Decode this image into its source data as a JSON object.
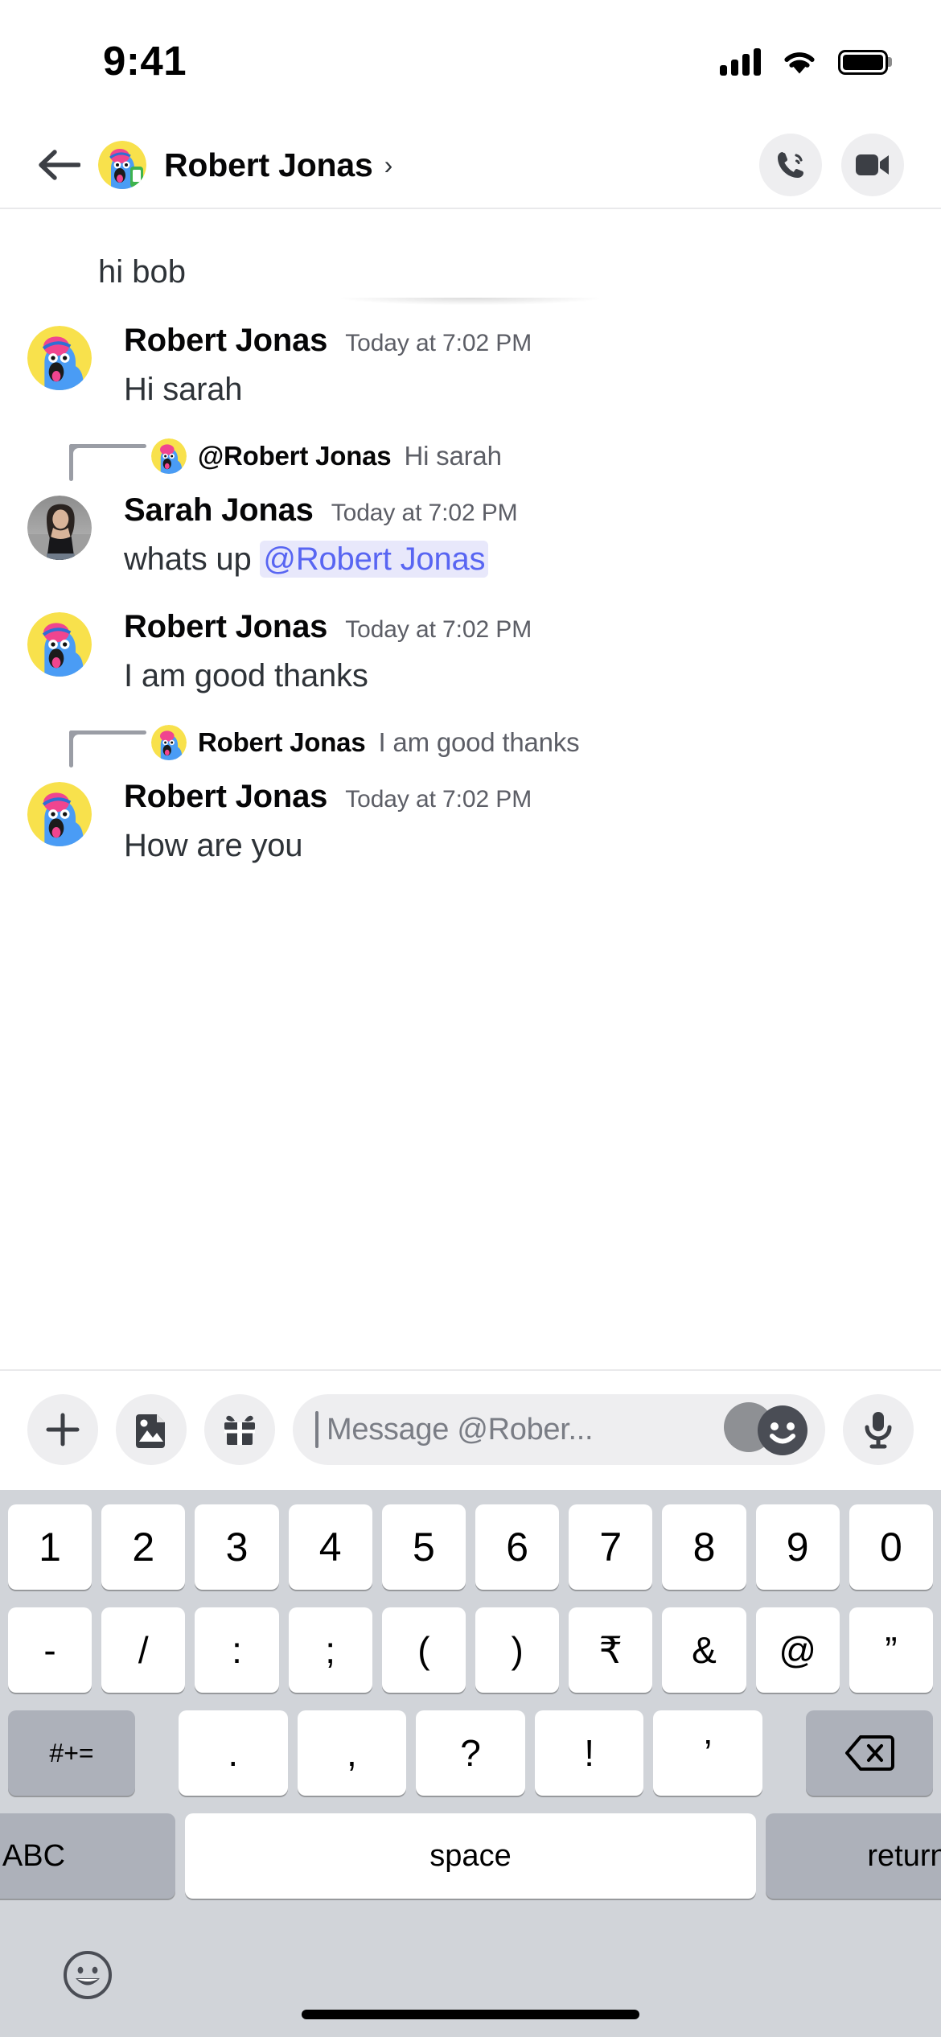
{
  "status_bar": {
    "time": "9:41",
    "cellular_icon": "cellular-signal-icon",
    "wifi_icon": "wifi-icon",
    "battery_icon": "battery-full-icon"
  },
  "header": {
    "back_icon": "back-arrow-icon",
    "avatar_name": "Robert Jonas avatar",
    "title": "Robert Jonas",
    "chevron": "›",
    "call_icon": "phone-call-icon",
    "video_icon": "video-camera-icon"
  },
  "messages": {
    "top_partial_text": "hi bob",
    "items": [
      {
        "type": "message",
        "author": "Robert Jonas",
        "timestamp": "Today at 7:02 PM",
        "text": "Hi sarah"
      },
      {
        "type": "reply",
        "reply_author": "@Robert Jonas",
        "reply_text": "Hi sarah",
        "author": "Sarah Jonas",
        "timestamp": "Today at 7:02 PM",
        "text_before": "whats up ",
        "mention": "@Robert Jonas"
      },
      {
        "type": "message",
        "author": "Robert Jonas",
        "timestamp": "Today at 7:02 PM",
        "text": "I am good thanks"
      },
      {
        "type": "reply",
        "reply_author": "Robert Jonas",
        "reply_text": "I am good thanks",
        "author": "Robert Jonas",
        "timestamp": "Today at 7:02 PM",
        "text": "How are you"
      }
    ]
  },
  "composer": {
    "add_icon": "plus-icon",
    "image_icon": "image-sticker-icon",
    "gift_icon": "gift-icon",
    "placeholder": "Message @Rober...",
    "emoji_icon": "emoji-smiley-icon",
    "mic_icon": "microphone-icon"
  },
  "keyboard": {
    "row_numbers": [
      "1",
      "2",
      "3",
      "4",
      "5",
      "6",
      "7",
      "8",
      "9",
      "0"
    ],
    "row_symbols": [
      "-",
      "/",
      ":",
      ";",
      "(",
      ")",
      "₹",
      "&",
      "@",
      "”"
    ],
    "row_punct_left_label": "#+=",
    "row_punct": [
      ".",
      ",",
      "?",
      "!",
      "’"
    ],
    "backspace_icon": "backspace-delete-icon",
    "abc_label": "ABC",
    "space_label": "space",
    "return_label": "return",
    "emoji_key_icon": "keyboard-emoji-icon"
  },
  "colors": {
    "mention_text": "#5865f2",
    "mention_bg": "#e8e8fb",
    "keyboard_bg": "#d1d4d9",
    "key_dark": "#adb1ba",
    "timestamp": "#5c5e66",
    "avatar_yellow": "#f8e14c",
    "avatar_blue": "#4a9cf5",
    "avatar_pink": "#f0458f"
  }
}
